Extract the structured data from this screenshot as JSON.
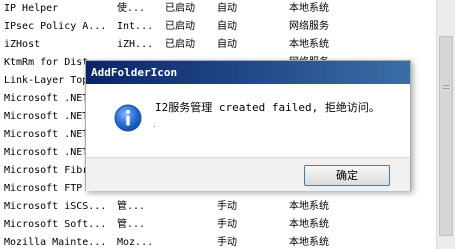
{
  "services": [
    {
      "name": "IP Helper",
      "desc": "使...",
      "status": "已启动",
      "startup": "自动",
      "logon": "本地系统"
    },
    {
      "name": "IPsec Policy A...",
      "desc": "Int...",
      "status": "已启动",
      "startup": "自动",
      "logon": "网络服务"
    },
    {
      "name": "iZHost",
      "desc": "iZH...",
      "status": "已启动",
      "startup": "自动",
      "logon": "本地系统"
    },
    {
      "name": "KtmRm for Dist",
      "desc": "",
      "status": "",
      "startup": "",
      "logon": "网络服务"
    },
    {
      "name": "Link-Layer Top",
      "desc": "",
      "status": "",
      "startup": "",
      "logon": ""
    },
    {
      "name": "Microsoft .NET",
      "desc": "",
      "status": "",
      "startup": "",
      "logon": ""
    },
    {
      "name": "Microsoft .NET",
      "desc": "",
      "status": "",
      "startup": "",
      "logon": ""
    },
    {
      "name": "Microsoft .NET",
      "desc": "",
      "status": "",
      "startup": "",
      "logon": ""
    },
    {
      "name": "Microsoft .NET",
      "desc": "",
      "status": "",
      "startup": "",
      "logon": ""
    },
    {
      "name": "Microsoft Fibr",
      "desc": "",
      "status": "",
      "startup": "",
      "logon": ""
    },
    {
      "name": "Microsoft FTP",
      "desc": "",
      "status": "",
      "startup": "",
      "logon": ""
    },
    {
      "name": "Microsoft iSCS...",
      "desc": "管...",
      "status": "",
      "startup": "手动",
      "logon": "本地系统"
    },
    {
      "name": "Microsoft Soft...",
      "desc": "管...",
      "status": "",
      "startup": "手动",
      "logon": "本地系统"
    },
    {
      "name": "Mozilla Mainte...",
      "desc": "Moz...",
      "status": "",
      "startup": "手动",
      "logon": "本地系统"
    }
  ],
  "dialog": {
    "title": "AddFolderIcon",
    "message": "I2服务管理 created failed, 拒绝访问。",
    "ok_label": "确定",
    "icon": "info-icon"
  }
}
